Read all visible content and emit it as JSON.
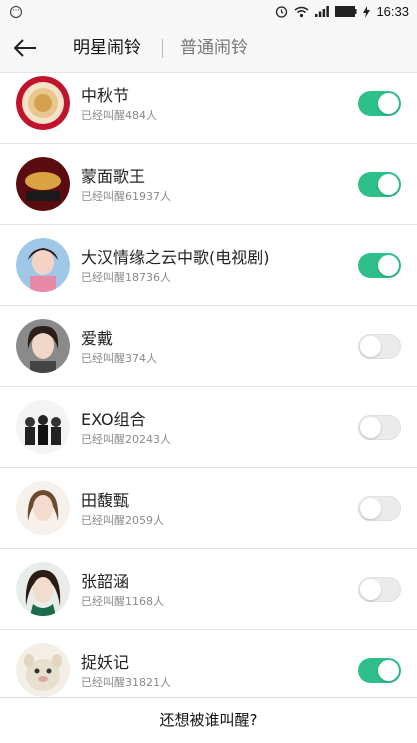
{
  "status": {
    "time": "16:33"
  },
  "header": {
    "back_icon": "arrow-left-icon",
    "tabs": [
      {
        "label": "明星闹铃",
        "active": true
      },
      {
        "label": "普通闹铃",
        "active": false
      }
    ]
  },
  "items": [
    {
      "name": "中秋节",
      "count": "已经叫醒484人",
      "enabled": true
    },
    {
      "name": "蒙面歌王",
      "count": "已经叫醒61937人",
      "enabled": true
    },
    {
      "name": "大汉情缘之云中歌(电视剧)",
      "count": "已经叫醒18736人",
      "enabled": true
    },
    {
      "name": "爱戴",
      "count": "已经叫醒374人",
      "enabled": false
    },
    {
      "name": "EXO组合",
      "count": "已经叫醒20243人",
      "enabled": false
    },
    {
      "name": "田馥甄",
      "count": "已经叫醒2059人",
      "enabled": false
    },
    {
      "name": "张韶涵",
      "count": "已经叫醒1168人",
      "enabled": false
    },
    {
      "name": "捉妖记",
      "count": "已经叫醒31821人",
      "enabled": true
    }
  ],
  "footer": {
    "label": "还想被谁叫醒?"
  },
  "colors": {
    "toggle_on": "#2fbf8a",
    "toggle_off": "#ebebeb"
  }
}
